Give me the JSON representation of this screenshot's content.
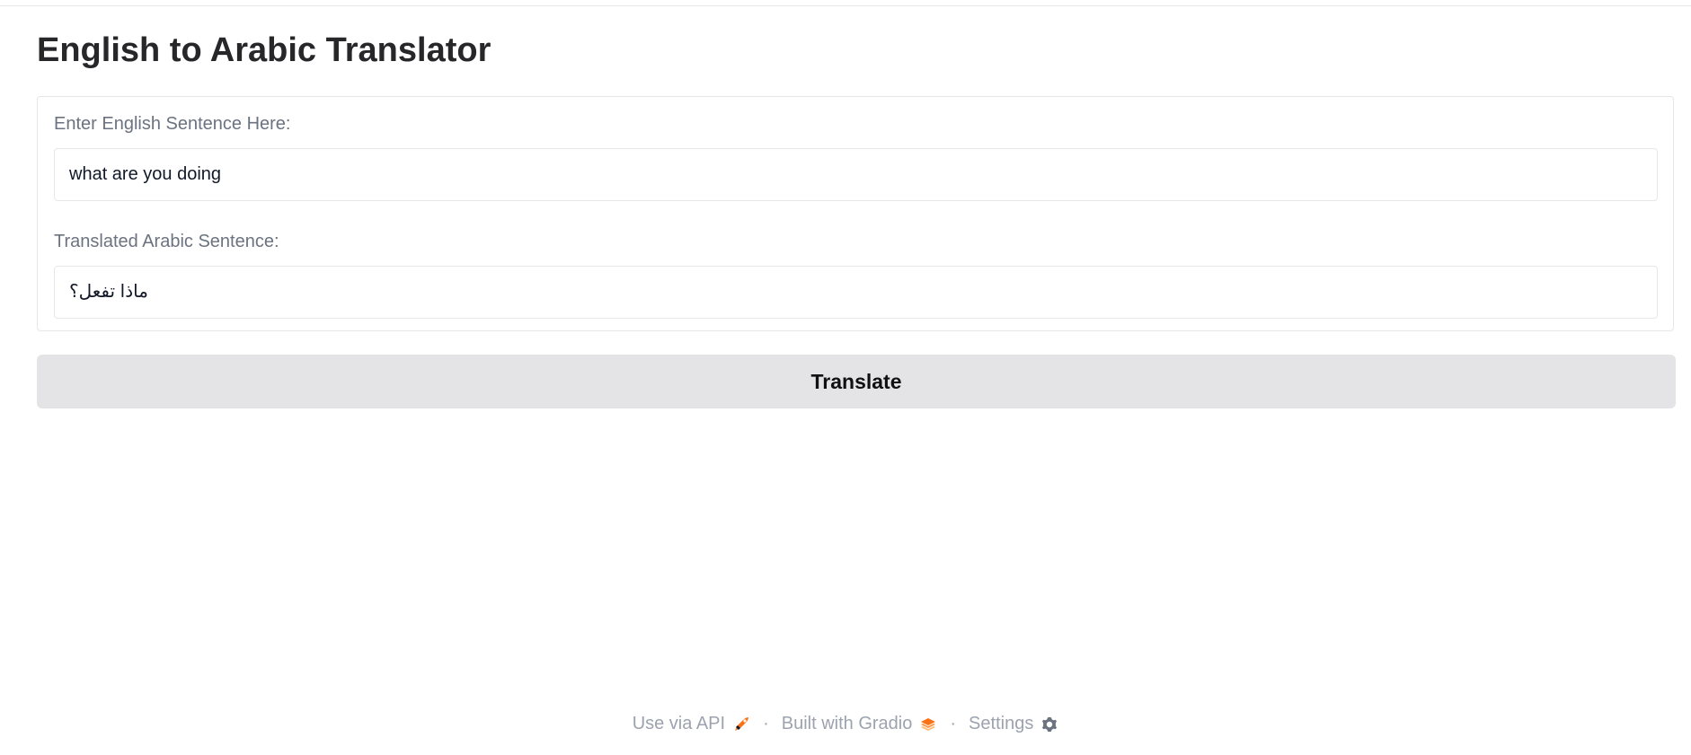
{
  "app": {
    "title": "English to Arabic Translator"
  },
  "input": {
    "label": "Enter English Sentence Here:",
    "value": "what are you doing"
  },
  "output": {
    "label": "Translated Arabic Sentence:",
    "value": "ماذا تفعل؟"
  },
  "actions": {
    "translate_label": "Translate"
  },
  "footer": {
    "api_label": "Use via API",
    "separator": "·",
    "gradio_label": "Built with Gradio",
    "settings_label": "Settings"
  },
  "icons": {
    "api": "rocket-icon",
    "gradio": "gradio-logo-icon",
    "settings": "gear-icon"
  },
  "colors": {
    "button_bg": "#e4e4e7",
    "label_text": "#6b7280",
    "footer_text": "#9ca3af",
    "accent_orange": "#f97316"
  }
}
